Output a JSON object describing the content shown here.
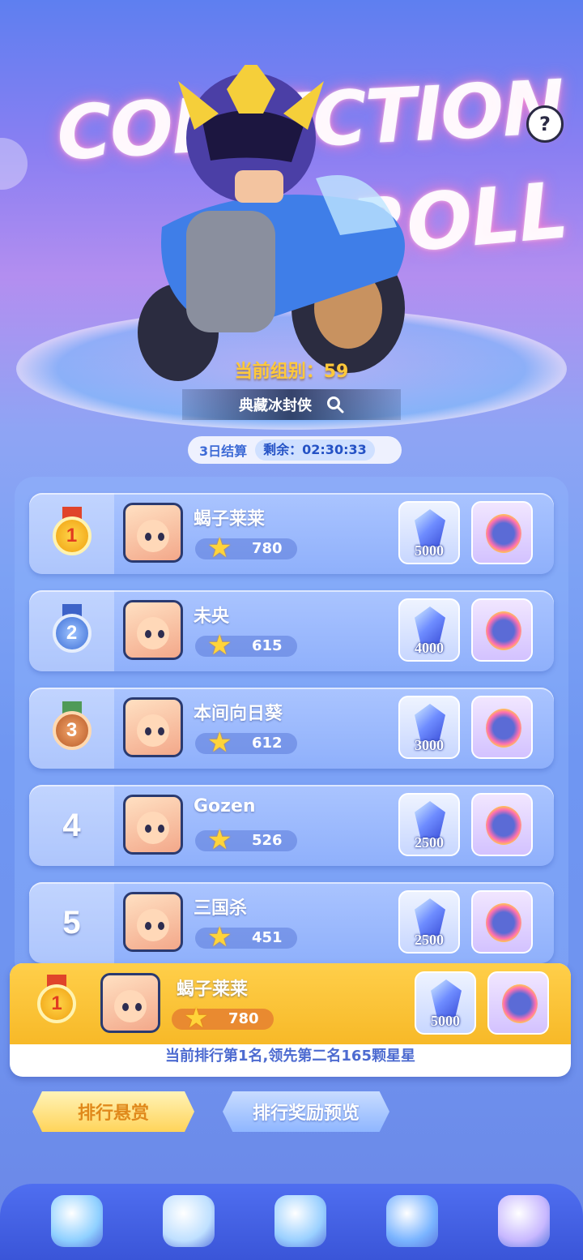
{
  "hero": {
    "title_word1": "COLLECTION",
    "title_word2": "ROLL",
    "group_label": "当前组别：59",
    "collection_name": "典藏冰封侠",
    "help_icon": "question-icon"
  },
  "timer": {
    "cycle": "3日结算",
    "remaining": "剩余：02:30:33"
  },
  "leaderboard": [
    {
      "rank": "1",
      "name": "蝎子莱莱",
      "score": "780",
      "gems": "5000",
      "medal": "gold"
    },
    {
      "rank": "2",
      "name": "未央",
      "score": "615",
      "gems": "4000",
      "medal": "silver"
    },
    {
      "rank": "3",
      "name": "本间向日葵",
      "score": "612",
      "gems": "3000",
      "medal": "bronze"
    },
    {
      "rank": "4",
      "name": "Gozen",
      "score": "526",
      "gems": "2500",
      "medal": ""
    },
    {
      "rank": "5",
      "name": "三国杀",
      "score": "451",
      "gems": "2500",
      "medal": ""
    }
  ],
  "my_rank": {
    "rank": "1",
    "name": "蝎子莱莱",
    "score": "780",
    "gems": "5000",
    "note": "当前排行第1名,领先第二名165颗星星"
  },
  "buttons": {
    "bounty": "排行悬赏",
    "preview": "排行奖励预览"
  },
  "nav": [
    "lottery-icon",
    "racing-icon",
    "gamepad-icon",
    "trophy-icon",
    "mystery-box-icon"
  ],
  "colors": {
    "gold": "#ffc93a",
    "accent_blue": "#3e6bd6",
    "my_row": "#f7b928"
  }
}
